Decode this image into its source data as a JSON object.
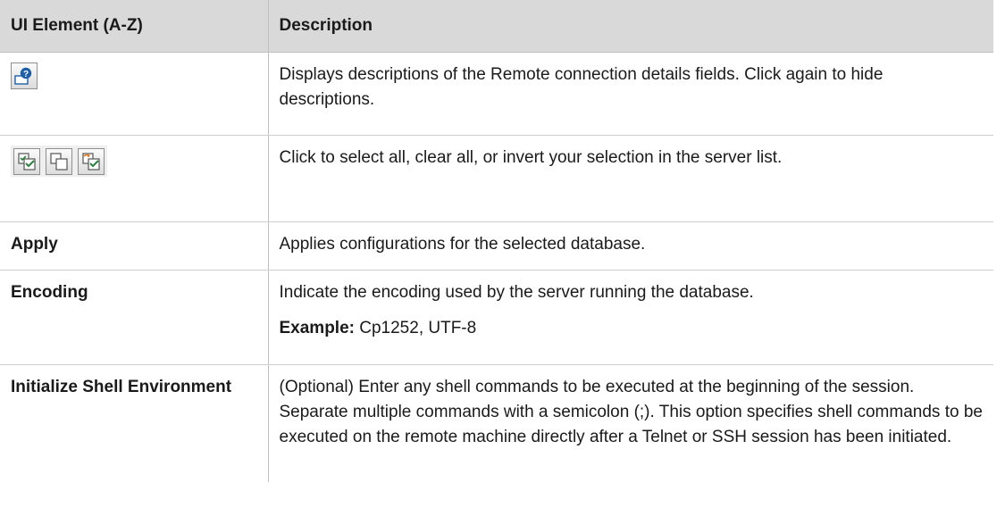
{
  "table": {
    "header": {
      "col1": "UI Element (A-Z)",
      "col2": "Description"
    },
    "rows": [
      {
        "element_icons": [
          "remote-connection-help-icon"
        ],
        "description": "Displays descriptions of the Remote connection details fields. Click again to hide descriptions."
      },
      {
        "element_icons": [
          "select-all-icon",
          "clear-all-icon",
          "invert-selection-icon"
        ],
        "description": "Click to select all, clear all, or invert your selection in the server list."
      },
      {
        "element": "Apply",
        "description": "Applies configurations for the selected database."
      },
      {
        "element": "Encoding",
        "description": "Indicate the encoding used by the server running the database.",
        "example_label": "Example:",
        "example_value": " Cp1252, UTF-8"
      },
      {
        "element": "Initialize Shell Environment",
        "description": "(Optional) Enter any shell commands to be executed at the beginning of the session. Separate multiple commands with a semicolon (;). This option specifies shell commands to be executed on the remote machine directly after a Telnet or SSH session has been initiated."
      }
    ]
  },
  "colors": {
    "header_bg": "#d9d9d9",
    "icon_accent": "#2a7f3a",
    "icon_blue": "#1f5fa8",
    "icon_orange": "#e07a1f"
  }
}
